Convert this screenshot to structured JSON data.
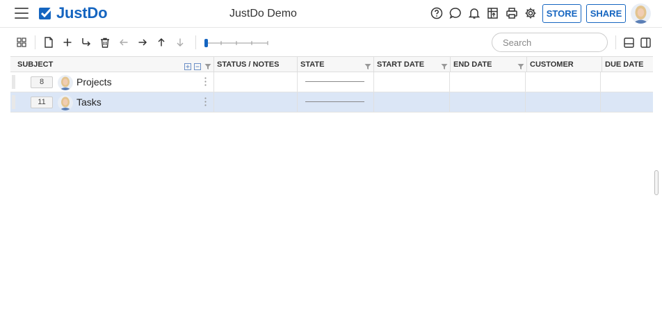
{
  "app": {
    "logo_text": "JustDo",
    "project_title": "JustDo Demo",
    "brand_color": "#1565c0"
  },
  "topbar": {
    "icons": [
      "help-icon",
      "chat-icon",
      "bell-icon",
      "apps-icon",
      "print-icon",
      "settings-icon"
    ],
    "store_label": "STORE",
    "share_label": "SHARE"
  },
  "toolbar": {
    "icons": [
      "grid-view-icon",
      "new-file-icon",
      "add-icon",
      "add-subtask-icon",
      "delete-icon",
      "arrow-left-icon",
      "arrow-right-icon",
      "arrow-up-icon",
      "arrow-down-icon"
    ],
    "search_placeholder": "Search",
    "layout_icons": [
      "split-horizontal-icon",
      "split-vertical-icon"
    ]
  },
  "grid": {
    "columns": [
      {
        "key": "subject",
        "label": "SUBJECT"
      },
      {
        "key": "status",
        "label": "STATUS / NOTES"
      },
      {
        "key": "state",
        "label": "STATE"
      },
      {
        "key": "start",
        "label": "START DATE"
      },
      {
        "key": "end",
        "label": "END DATE"
      },
      {
        "key": "customer",
        "label": "CUSTOMER"
      },
      {
        "key": "due",
        "label": "DUE DATE"
      }
    ],
    "rows": [
      {
        "seq": "8",
        "title": "Projects",
        "selected": false
      },
      {
        "seq": "11",
        "title": "Tasks",
        "selected": true
      }
    ]
  }
}
